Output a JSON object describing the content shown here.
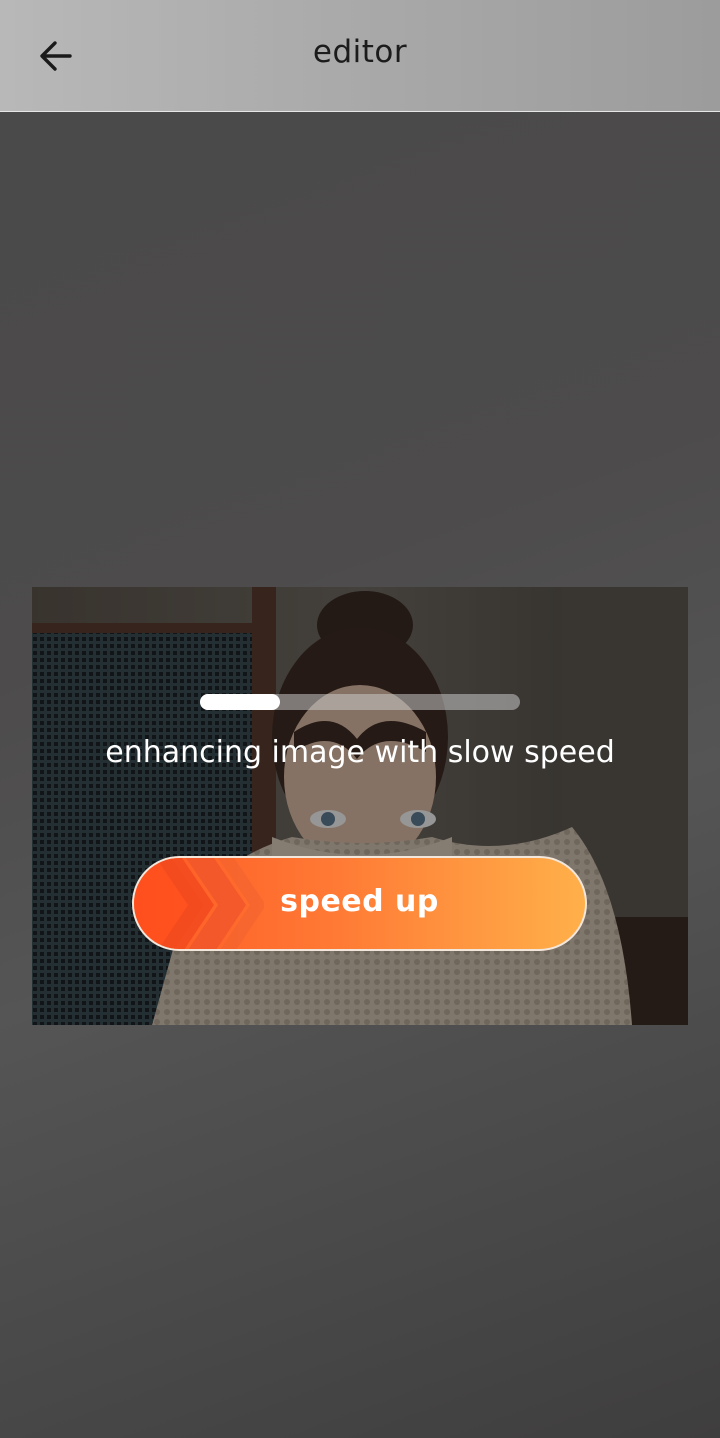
{
  "header": {
    "title": "editor",
    "back_icon": "arrow-left-icon"
  },
  "enhancer": {
    "progress": 0.25,
    "status_text": "enhancing image with slow speed",
    "speed_up_label": "speed up",
    "speed_icon": "chevrons-right-icon"
  },
  "colors": {
    "button_start": "#ff5a24",
    "button_end": "#ffb04a",
    "header_bg": "#aaaaaa"
  }
}
